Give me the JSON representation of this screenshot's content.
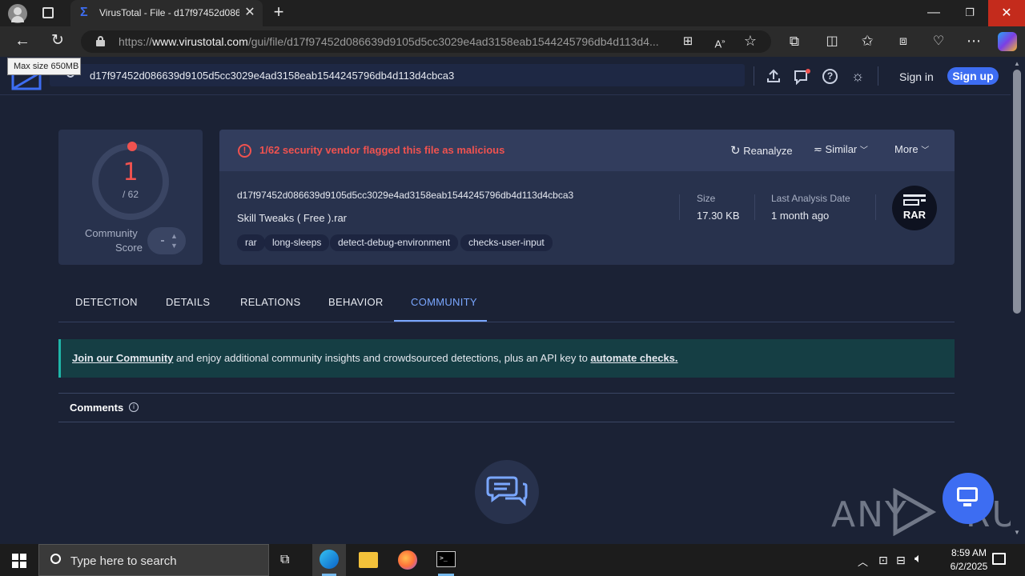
{
  "browser": {
    "tab_title": "VirusTotal - File - d17f97452d0866",
    "url_prefix": "https://",
    "url_domain": "www.virustotal.com",
    "url_path": "/gui/file/d17f97452d086639d9105d5cc3029e4ad3158eab1544245796db4d113d4...",
    "tooltip": "Max size 650MB"
  },
  "vt": {
    "search_value": "d17f97452d086639d9105d5cc3029e4ad3158eab1544245796db4d113d4cbca3",
    "signin": "Sign in",
    "signup": "Sign up"
  },
  "score": {
    "detections": "1",
    "total": "/ 62",
    "community_label_1": "Community",
    "community_label_2": "Score"
  },
  "alert": {
    "text": "1/62 security vendor flagged this file as malicious",
    "reanalyze": "Reanalyze",
    "similar": "Similar",
    "more": "More"
  },
  "file": {
    "hash": "d17f97452d086639d9105d5cc3029e4ad3158eab1544245796db4d113d4cbca3",
    "name": "Skill Tweaks ( Free ).rar",
    "tags": [
      "rar",
      "long-sleeps",
      "detect-debug-environment",
      "checks-user-input"
    ],
    "size_label": "Size",
    "size_value": "17.30 KB",
    "date_label": "Last Analysis Date",
    "date_value": "1 month ago",
    "type_badge": "RAR"
  },
  "tabs": [
    "DETECTION",
    "DETAILS",
    "RELATIONS",
    "BEHAVIOR",
    "COMMUNITY"
  ],
  "active_tab": "COMMUNITY",
  "banner": {
    "link1": "Join our Community",
    "middle": " and enjoy additional community insights and crowdsourced detections, plus an API key to ",
    "link2": "automate checks."
  },
  "comments_title": "Comments",
  "watermark": "ANY RUN",
  "taskbar": {
    "search_placeholder": "Type here to search",
    "time": "8:59 AM",
    "date": "6/2/2025"
  },
  "colors": {
    "alert_red": "#f0524f",
    "accent_blue": "#3d6df2",
    "active_tab": "#7aa7ff",
    "banner_teal": "#1fb5a8"
  }
}
